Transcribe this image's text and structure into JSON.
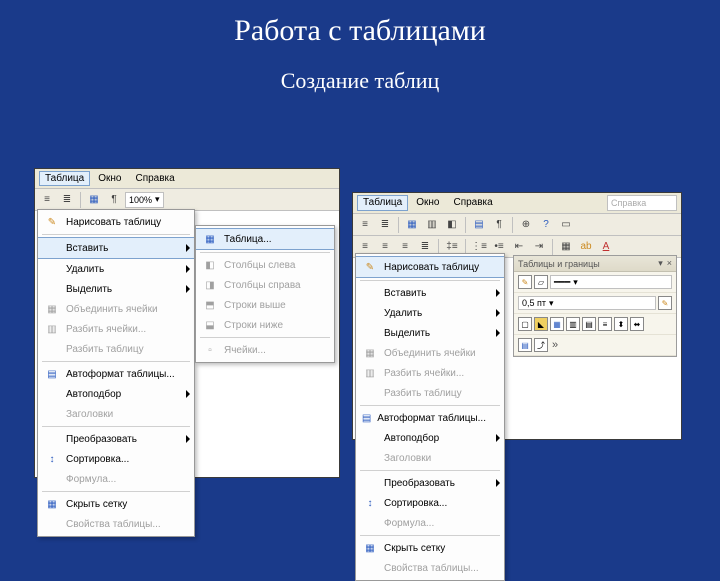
{
  "slide": {
    "title": "Работа с таблицами",
    "subtitle": "Создание таблиц"
  },
  "left": {
    "menubar": {
      "items": [
        "Таблица",
        "Окно",
        "Справка"
      ]
    },
    "toolbar": {
      "zoom": "100%"
    },
    "menu": {
      "items": [
        {
          "label": "Нарисовать таблицу",
          "icon": "✎"
        },
        {
          "label": "Вставить",
          "sel": true,
          "sub": true
        },
        {
          "label": "Удалить",
          "sub": true
        },
        {
          "label": "Выделить",
          "sub": true
        },
        {
          "label": "Объединить ячейки",
          "disabled": true,
          "icon": "▦"
        },
        {
          "label": "Разбить ячейки...",
          "disabled": true,
          "icon": "▥"
        },
        {
          "label": "Разбить таблицу",
          "disabled": true
        },
        {
          "label": "Автоформат таблицы...",
          "icon": "▤"
        },
        {
          "label": "Автоподбор",
          "sub": true
        },
        {
          "label": "Заголовки",
          "disabled": true
        },
        {
          "label": "Преобразовать",
          "sub": true
        },
        {
          "label": "Сортировка...",
          "icon": "↕"
        },
        {
          "label": "Формула...",
          "disabled": true
        },
        {
          "label": "Скрыть сетку",
          "icon": "▦"
        },
        {
          "label": "Свойства таблицы...",
          "disabled": true
        }
      ]
    },
    "submenu": {
      "items": [
        {
          "label": "Таблица...",
          "sel": true,
          "icon": "▦"
        },
        {
          "label": "Столбцы слева",
          "disabled": true,
          "icon": "◧"
        },
        {
          "label": "Столбцы справа",
          "disabled": true,
          "icon": "◨"
        },
        {
          "label": "Строки выше",
          "disabled": true,
          "icon": "⬒"
        },
        {
          "label": "Строки ниже",
          "disabled": true,
          "icon": "⬓"
        },
        {
          "label": "Ячейки...",
          "disabled": true,
          "icon": "▫"
        }
      ]
    }
  },
  "right": {
    "menubar": {
      "items": [
        "Таблица",
        "Окно",
        "Справка"
      ]
    },
    "toolbar": {
      "help_placeholder": "Справка"
    },
    "menu": {
      "items": [
        {
          "label": "Нарисовать таблицу",
          "sel": true,
          "icon": "✎"
        },
        {
          "label": "Вставить",
          "sub": true
        },
        {
          "label": "Удалить",
          "sub": true
        },
        {
          "label": "Выделить",
          "sub": true
        },
        {
          "label": "Объединить ячейки",
          "disabled": true,
          "icon": "▦"
        },
        {
          "label": "Разбить ячейки...",
          "disabled": true,
          "icon": "▥"
        },
        {
          "label": "Разбить таблицу",
          "disabled": true
        },
        {
          "label": "Автоформат таблицы...",
          "icon": "▤"
        },
        {
          "label": "Автоподбор",
          "sub": true
        },
        {
          "label": "Заголовки",
          "disabled": true
        },
        {
          "label": "Преобразовать",
          "sub": true
        },
        {
          "label": "Сортировка...",
          "icon": "↕"
        },
        {
          "label": "Формула...",
          "disabled": true
        },
        {
          "label": "Скрыть сетку",
          "icon": "▦"
        },
        {
          "label": "Свойства таблицы...",
          "disabled": true
        }
      ]
    },
    "panel": {
      "title": "Таблицы и границы",
      "close": "×",
      "line_weight": "0,5 пт"
    }
  }
}
